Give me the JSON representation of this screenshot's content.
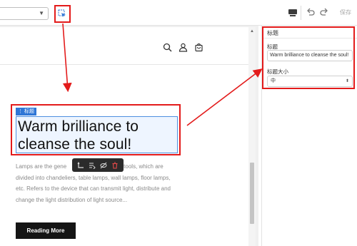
{
  "toolbar": {
    "page_select_value": "",
    "save_label": "保存",
    "icons": [
      "select-element-icon",
      "device-preview-icon",
      "undo-icon",
      "redo-icon"
    ]
  },
  "page": {
    "header_icons": [
      "search-icon",
      "user-icon",
      "cart-icon"
    ],
    "heading_tag_label": "标题",
    "heading_text": "Warm brilliance to cleanse the soul!",
    "body_text_start": "Lamps are the gene",
    "body_text_rest": "tools, which are divided into chandeliers, table lamps, wall lamps, floor lamps, etc. Refers to the device that can transmit light, distribute and change the light distribution of light source...",
    "reading_button_label": "Reading More",
    "mini_toolbar_icons": [
      "move-icon",
      "layers-icon",
      "hide-icon",
      "delete-icon"
    ]
  },
  "panel": {
    "title": "标题",
    "title_field_label": "标题",
    "title_field_value": "Warm brilliance to cleanse the soul!",
    "size_field_label": "标题大小",
    "size_value": "中"
  },
  "colors": {
    "annotation_red": "#e31b1b",
    "selection_blue": "#2f76d6",
    "button_dark": "#151515"
  }
}
